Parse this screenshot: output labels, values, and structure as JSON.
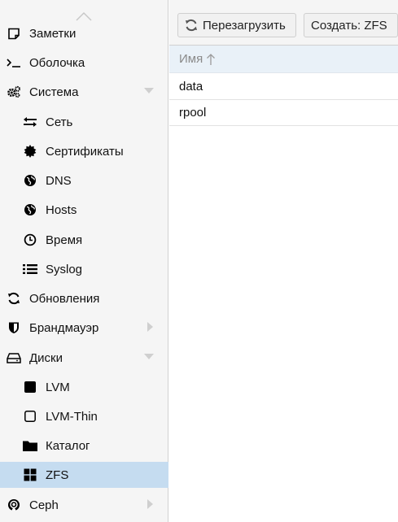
{
  "sidebar": {
    "items": [
      {
        "label": "Заметки",
        "icon": "note-icon"
      },
      {
        "label": "Оболочка",
        "icon": "terminal-icon"
      },
      {
        "label": "Система",
        "icon": "cogs-icon"
      },
      {
        "label": "Сеть",
        "icon": "exchange-icon"
      },
      {
        "label": "Сертификаты",
        "icon": "certificate-icon"
      },
      {
        "label": "DNS",
        "icon": "globe-icon"
      },
      {
        "label": "Hosts",
        "icon": "globe-icon"
      },
      {
        "label": "Время",
        "icon": "clock-icon"
      },
      {
        "label": "Syslog",
        "icon": "list-icon"
      },
      {
        "label": "Обновления",
        "icon": "refresh-icon"
      },
      {
        "label": "Брандмауэр",
        "icon": "shield-icon"
      },
      {
        "label": "Диски",
        "icon": "hdd-icon"
      },
      {
        "label": "LVM",
        "icon": "square-icon"
      },
      {
        "label": "LVM-Thin",
        "icon": "square-outline-icon"
      },
      {
        "label": "Каталог",
        "icon": "folder-icon"
      },
      {
        "label": "ZFS",
        "icon": "th-large-icon"
      },
      {
        "label": "Ceph",
        "icon": "ceph-icon"
      }
    ],
    "selected": "ZFS"
  },
  "toolbar": {
    "reload_label": "Перезагрузить",
    "create_label": "Создать: ZFS"
  },
  "grid": {
    "column": "Имя",
    "sort": "ascending",
    "rows": [
      "data",
      "rpool"
    ]
  },
  "colors": {
    "selected_bg": "#c5dcf0",
    "header_bg": "#e9f1f8",
    "sidebar_bg": "#f5f5f5"
  }
}
